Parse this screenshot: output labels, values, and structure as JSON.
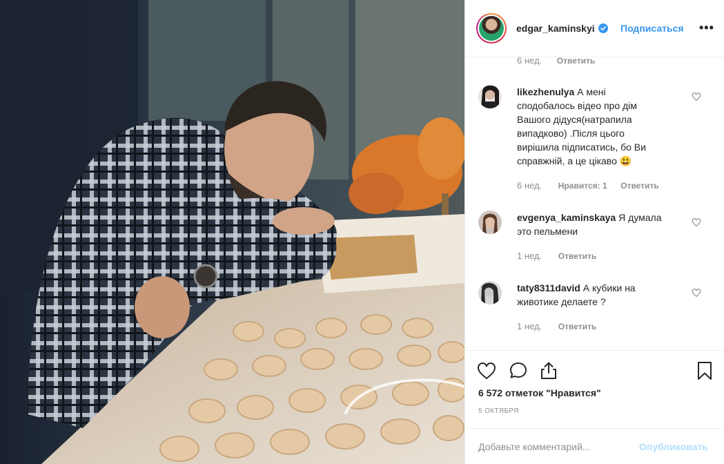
{
  "post": {
    "username": "edgar_kaminskyi",
    "verified": true,
    "follow_label": "Подписаться",
    "more_label": "•••"
  },
  "top_meta": {
    "time": "6 нед.",
    "reply": "Ответить"
  },
  "comments": [
    {
      "username": "likezhenulya",
      "lines": [
        "А мені",
        "сподобалось відео про дім",
        "Вашого дідуся(натрапила",
        "випадково) .Після цього",
        "вирішила підписатись, бо Ви",
        "справжній, а це цікаво 😃"
      ],
      "time": "6 нед.",
      "likes": "Нравится: 1",
      "reply": "Ответить"
    },
    {
      "username": "evgenya_kaminskaya",
      "lines": [
        "Я думала",
        "это пельмени"
      ],
      "time": "1 нед.",
      "reply": "Ответить"
    },
    {
      "username": "taty8311david",
      "lines": [
        "А кубики на",
        "животике делаете ?"
      ],
      "time": "1 нед.",
      "reply": "Ответить"
    }
  ],
  "actions": {
    "like_icon": "heart-icon",
    "comment_icon": "comment-icon",
    "share_icon": "share-icon",
    "save_icon": "bookmark-icon"
  },
  "likes_text": "6 572 отметок \"Нравится\"",
  "date_text": "5 ОКТЯБРЯ",
  "add_comment": {
    "placeholder": "Добавьте комментарий...",
    "publish_label": "Опубликовать"
  },
  "colors": {
    "accent": "#3897f0",
    "publish_disabled": "#b2dffc",
    "muted": "#8e8e8e",
    "text": "#262626"
  }
}
